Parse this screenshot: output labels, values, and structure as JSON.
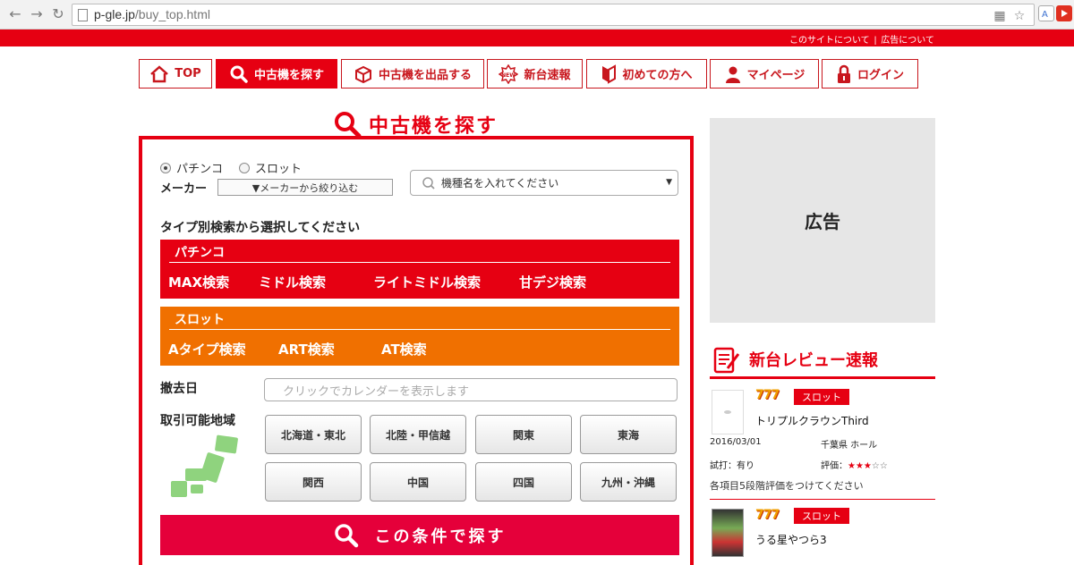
{
  "browser": {
    "url_host": "p-gle.jp",
    "url_path": "/buy_top.html"
  },
  "topbar": {
    "links": [
      "このサイトについて",
      "広告について"
    ],
    "separator": "|"
  },
  "nav": {
    "items": [
      {
        "label": "TOP",
        "icon": "home-icon"
      },
      {
        "label": "中古機を探す",
        "icon": "search-icon",
        "active": true
      },
      {
        "label": "中古機を出品する",
        "icon": "box-icon"
      },
      {
        "label": "新台速報",
        "icon": "new-badge-icon"
      },
      {
        "label": "初めての方へ",
        "icon": "beginner-mark-icon"
      },
      {
        "label": "マイページ",
        "icon": "user-icon"
      },
      {
        "label": "ログイン",
        "icon": "lock-icon"
      }
    ]
  },
  "search": {
    "title": "中古機を探す",
    "radio_pachinko": "パチンコ",
    "radio_slot": "スロット",
    "selected_radio": "パチンコ",
    "maker_label": "メーカー",
    "maker_select": "▼メーカーから絞り込む",
    "model_placeholder": "機種名を入れてください",
    "type_heading": "タイプ別検索から選択してください",
    "pachinko_block": {
      "title": "パチンコ",
      "links": [
        "MAX検索",
        "ミドル検索",
        "ライトミドル検索",
        "甘デジ検索"
      ]
    },
    "slot_block": {
      "title": "スロット",
      "links": [
        "Aタイプ検索",
        "ART検索",
        "AT検索"
      ]
    },
    "removal_label": "撤去日",
    "calendar_placeholder": "クリックでカレンダーを表示します",
    "region_label": "取引可能地域",
    "regions": [
      "北海道・東北",
      "北陸・甲信越",
      "関東",
      "東海",
      "関西",
      "中国",
      "四国",
      "九州・沖縄"
    ],
    "submit_label": "この条件で探す"
  },
  "sidebar": {
    "ad_label": "広告",
    "review_title": "新台レビュー速報",
    "reviews": [
      {
        "sevens": "777",
        "tag": "スロット",
        "name": "トリプルクラウンThird",
        "date": "2016/03/01",
        "location": "千葉県 ホール",
        "trial": "試打：有り",
        "rating_label": "評価：",
        "rating": 3,
        "rating_max": 5,
        "note": "各項目5段階評価をつけてください"
      },
      {
        "sevens": "777",
        "tag": "スロット",
        "name": "うる星やつら3"
      }
    ]
  },
  "colors": {
    "brand_red": "#e60012",
    "slot_orange": "#f07000",
    "submit_red": "#e5003a",
    "map_green": "#8fd37e"
  }
}
